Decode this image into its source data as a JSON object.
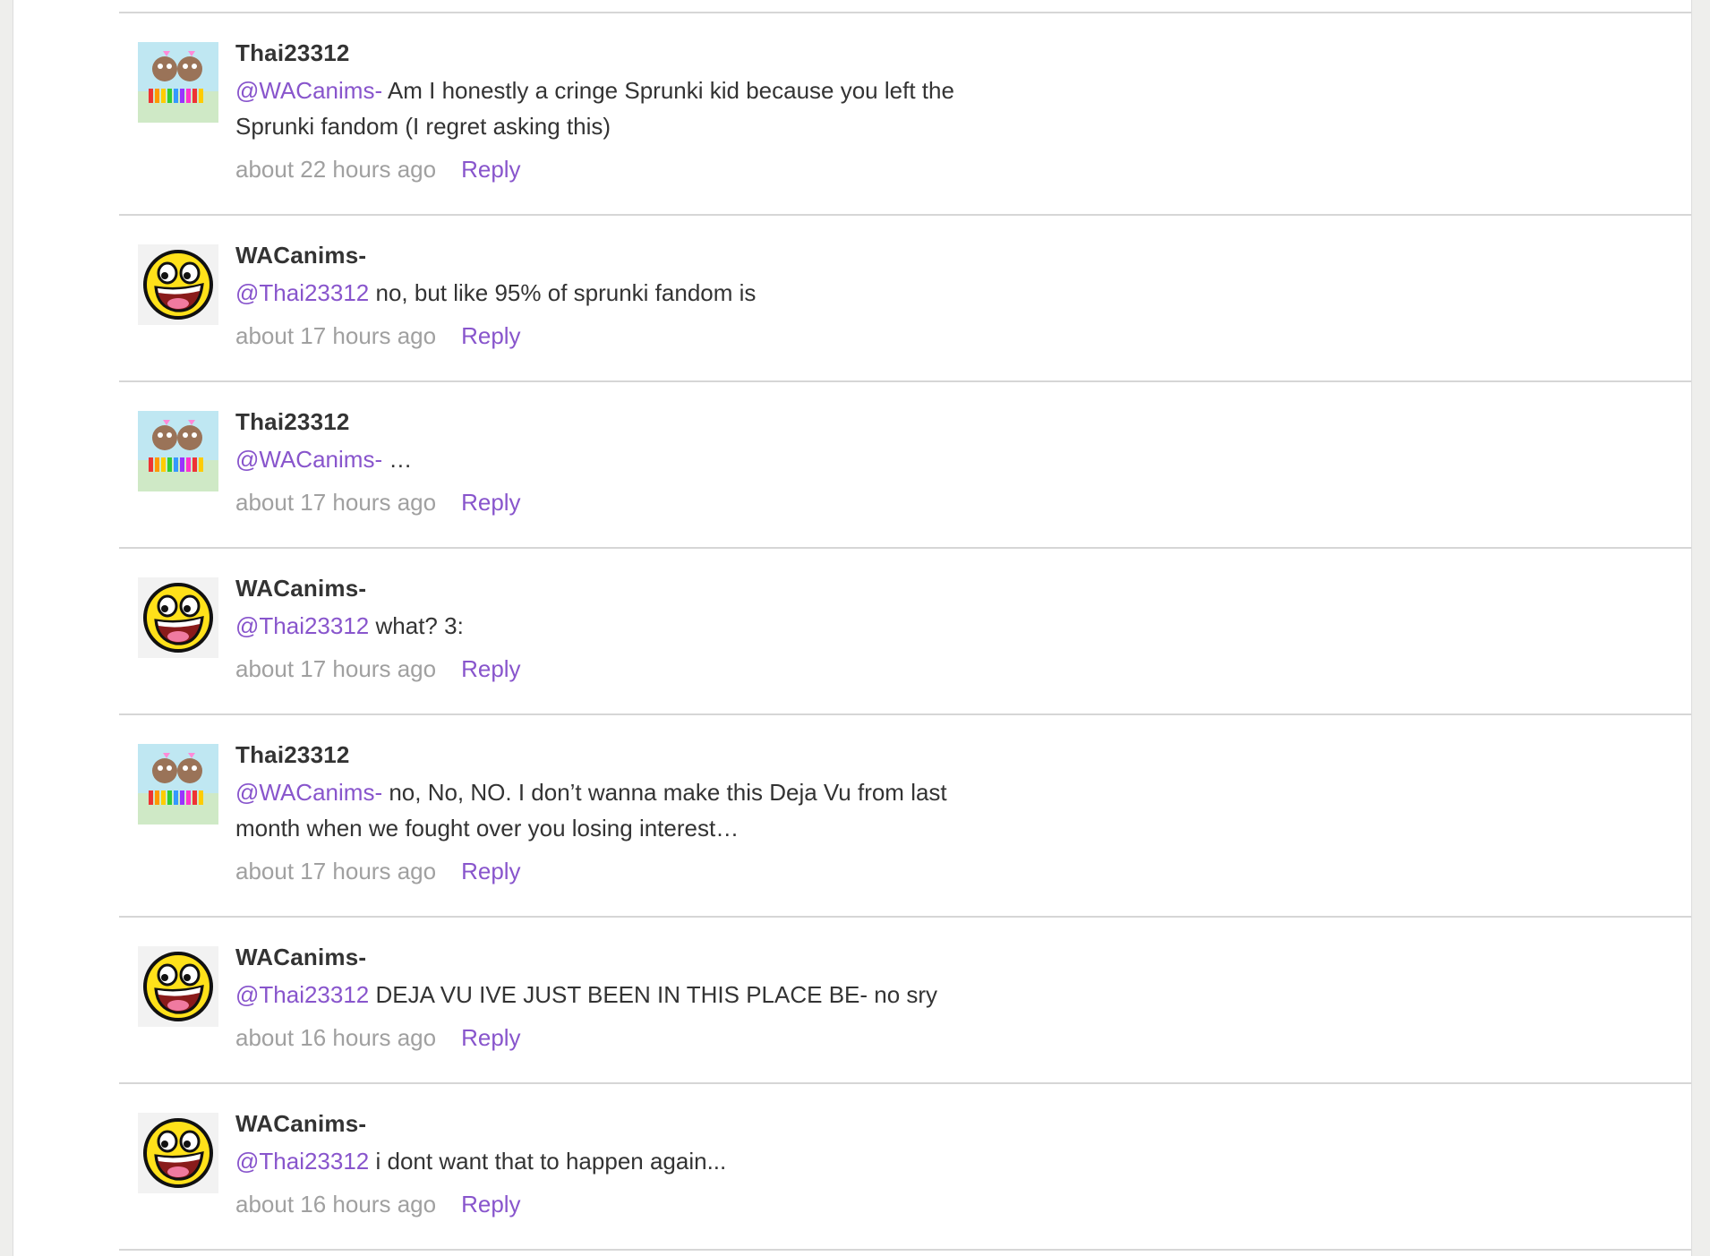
{
  "comments": [
    {
      "username": "Thai23312",
      "avatar": "sprunki-avatar",
      "mention": "@WACanims-",
      "text": " Am I honestly a cringe Sprunki kid because you left the Sprunki fandom (I regret asking this)",
      "time": "about 22 hours ago",
      "reply": "Reply"
    },
    {
      "username": "WACanims-",
      "avatar": "awesome-face-avatar",
      "mention": "@Thai23312",
      "text": " no, but like 95% of sprunki fandom is",
      "time": "about 17 hours ago",
      "reply": "Reply"
    },
    {
      "username": "Thai23312",
      "avatar": "sprunki-avatar",
      "mention": "@WACanims-",
      "text": " …",
      "time": "about 17 hours ago",
      "reply": "Reply"
    },
    {
      "username": "WACanims-",
      "avatar": "awesome-face-avatar",
      "mention": "@Thai23312",
      "text": " what? 3:",
      "time": "about 17 hours ago",
      "reply": "Reply"
    },
    {
      "username": "Thai23312",
      "avatar": "sprunki-avatar",
      "mention": "@WACanims-",
      "text": " no, No, NO. I don’t wanna make this Deja Vu from last month when we fought over you losing interest…",
      "time": "about 17 hours ago",
      "reply": "Reply"
    },
    {
      "username": "WACanims-",
      "avatar": "awesome-face-avatar",
      "mention": "@Thai23312",
      "text": " DEJA VU IVE JUST BEEN IN THIS PLACE BE- no sry",
      "time": "about 16 hours ago",
      "reply": "Reply"
    },
    {
      "username": "WACanims-",
      "avatar": "awesome-face-avatar",
      "mention": "@Thai23312",
      "text": " i dont want that to happen again...",
      "time": "about 16 hours ago",
      "reply": "Reply"
    }
  ],
  "colors": {
    "link": "#8855cc",
    "meta": "#a0a0a0",
    "text": "#333333",
    "divider": "#d6d6d6"
  }
}
